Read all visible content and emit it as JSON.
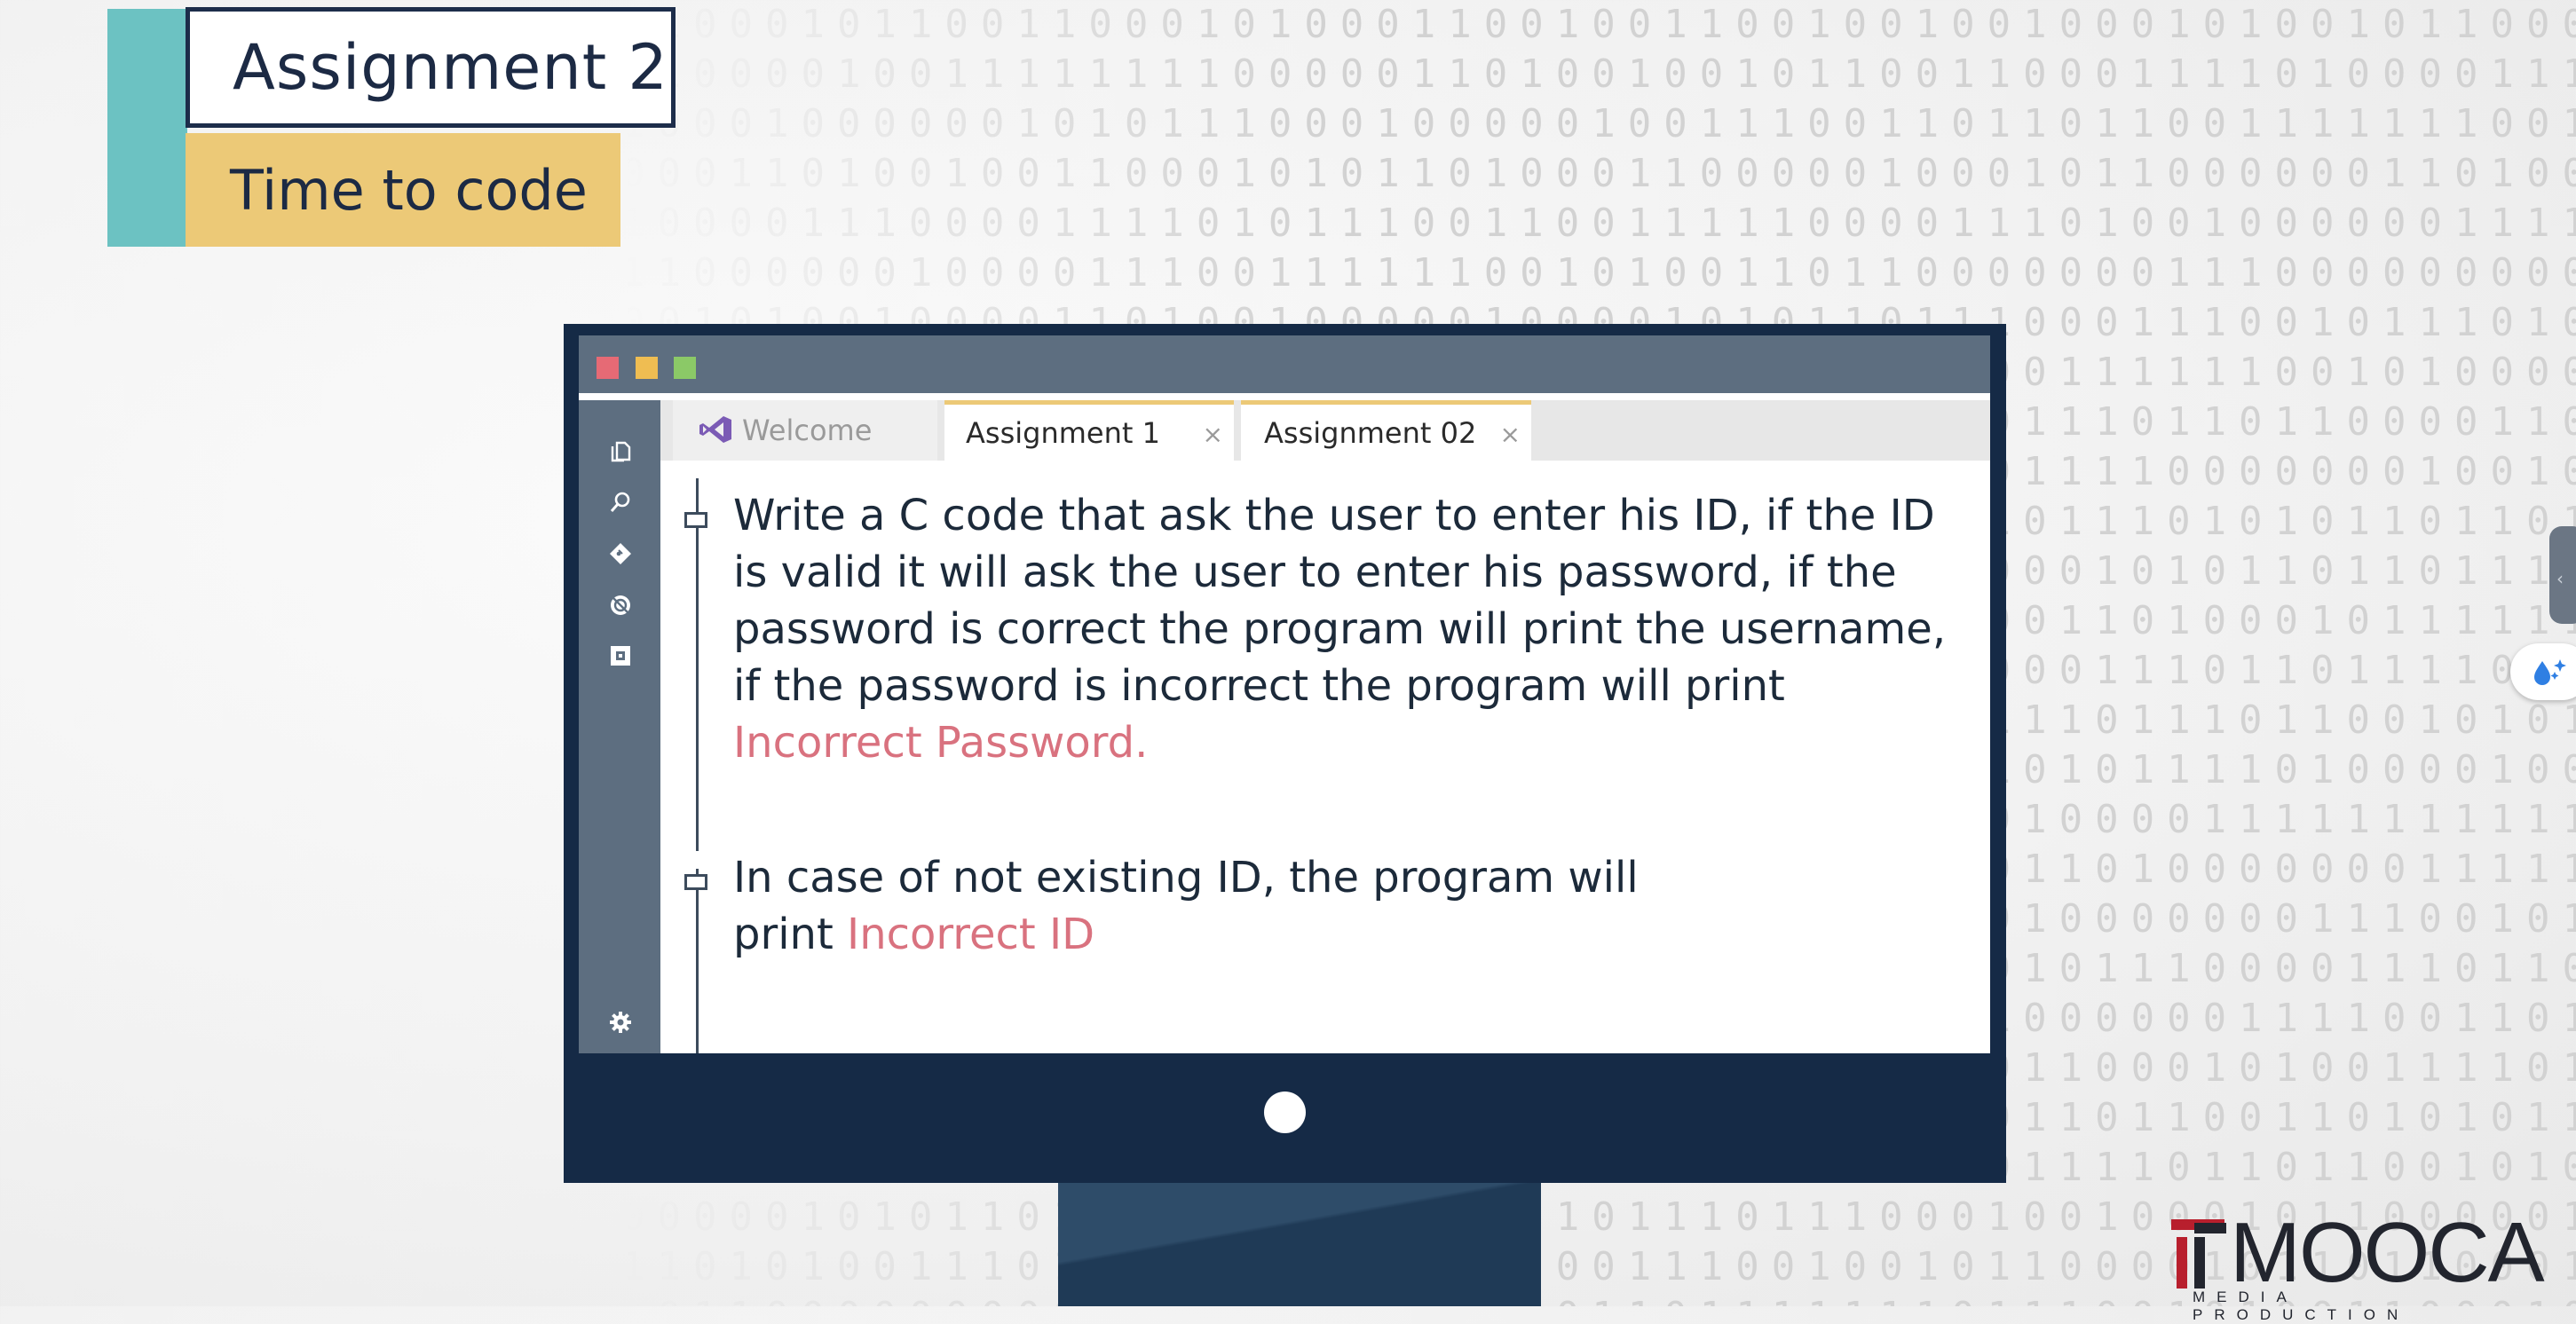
{
  "title_card": {
    "title": "Assignment 2",
    "subtitle": "Time to code",
    "accent_teal": "#6cc2c2",
    "accent_yellow": "#ecc977"
  },
  "editor_window": {
    "window_buttons": [
      "close",
      "minimize",
      "maximize"
    ],
    "sidebar_icons": [
      "files-icon",
      "search-icon",
      "git-icon",
      "debug-icon",
      "extensions-icon",
      "gear-icon"
    ],
    "tabs": [
      {
        "label": "Welcome",
        "icon": "visual-studio-icon",
        "active": false
      },
      {
        "label": "Assignment 1",
        "close": "×",
        "active": true
      },
      {
        "label": "Assignment 02",
        "close": "×",
        "active": true
      }
    ],
    "paragraph_1": {
      "text": "Write a C code that ask the user to enter his ID, if the ID is valid it will ask the user to enter his password, if the password is correct the program will print the username, if the password is incorrect the program will print ",
      "highlight": "Incorrect Password."
    },
    "paragraph_2": {
      "text": "In case of not existing ID, the program will print ",
      "highlight": "Incorrect ID"
    },
    "highlight_color": "#d9727f"
  },
  "logo": {
    "text": "MOOCA",
    "subtext": "MEDIA PRODUCTION"
  }
}
